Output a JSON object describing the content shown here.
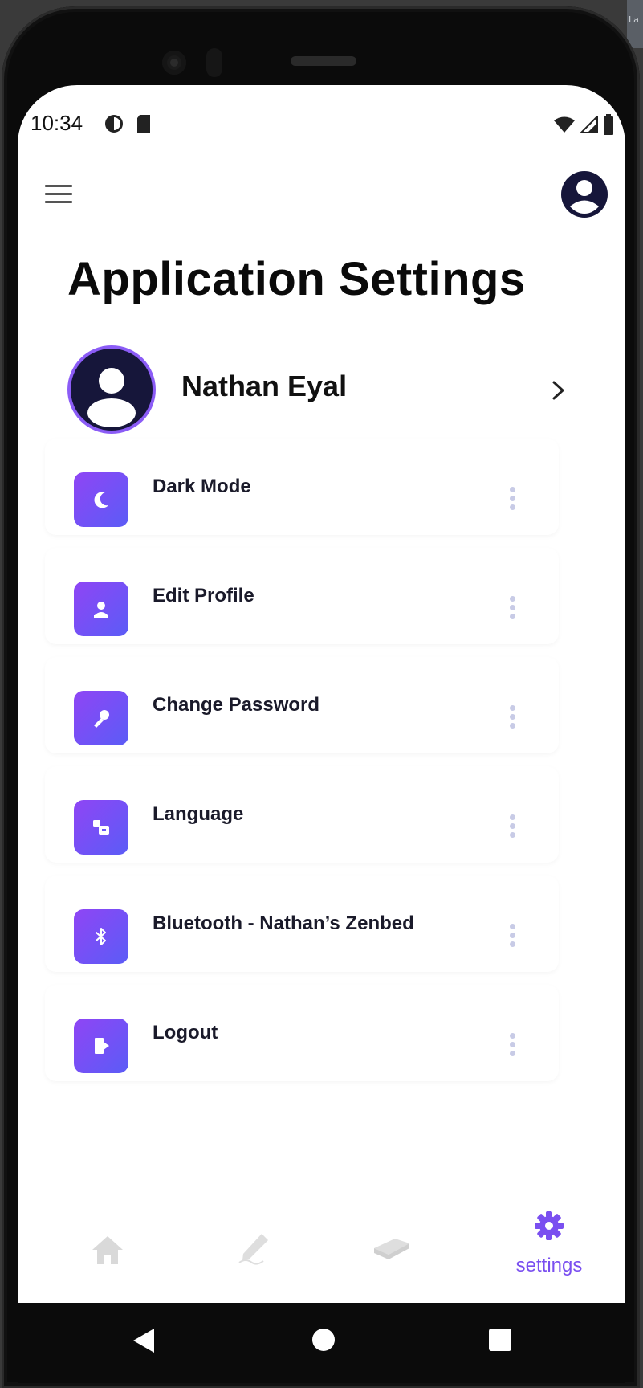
{
  "colors": {
    "accent": "#7a4ff0",
    "icon_gradient_start": "#8f45f5",
    "icon_gradient_end": "#5b5cf6",
    "avatar_dark": "#16163a",
    "avatar_ring": "#8b5cf6"
  },
  "status_bar": {
    "time": "10:34",
    "left_icons": [
      "notification-icon",
      "sd-card-icon"
    ],
    "right_icons": [
      "wifi-icon",
      "signal-icon",
      "battery-icon"
    ]
  },
  "app_bar": {
    "menu_icon": "hamburger-icon",
    "account_icon": "account-circle-icon"
  },
  "page": {
    "title": "Application Settings"
  },
  "profile": {
    "name": "Nathan Eyal",
    "chevron_icon": "chevron-right-icon"
  },
  "settings_items": [
    {
      "label": "Dark Mode",
      "icon": "moon-icon"
    },
    {
      "label": "Edit Profile",
      "icon": "edit-profile-icon"
    },
    {
      "label": "Change Password",
      "icon": "key-icon"
    },
    {
      "label": "Language",
      "icon": "translate-icon"
    },
    {
      "label": "Bluetooth - Nathan’s Zenbed",
      "icon": "bluetooth-icon"
    },
    {
      "label": "Logout",
      "icon": "logout-icon"
    }
  ],
  "bottom_nav": {
    "items": [
      {
        "icon": "home-icon",
        "label": ""
      },
      {
        "icon": "pen-icon",
        "label": ""
      },
      {
        "icon": "bed-icon",
        "label": ""
      },
      {
        "icon": "gear-icon",
        "label": "settings",
        "active": true
      }
    ]
  },
  "system_nav": {
    "icons": [
      "back-icon",
      "home-circle-icon",
      "recents-icon"
    ]
  }
}
